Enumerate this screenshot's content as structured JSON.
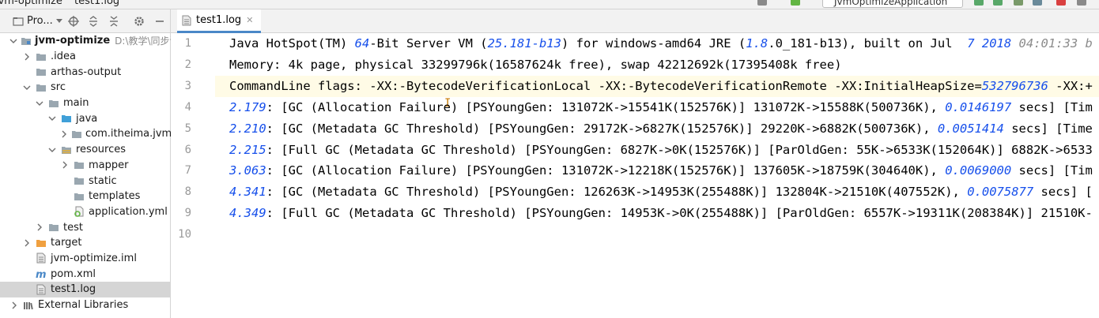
{
  "topbar": {
    "breadcrumb_project": "jvm-optimize",
    "breadcrumb_file": "test1.log",
    "run_config": "JvmOptimizeApplication"
  },
  "project_panel": {
    "title": "Pro..."
  },
  "tree": [
    {
      "label": "jvm-optimize",
      "path": "D:\\教学\\同步课",
      "indent": 0,
      "chevron": "down",
      "icon": "module"
    },
    {
      "label": ".idea",
      "indent": 1,
      "chevron": "right",
      "icon": "folder"
    },
    {
      "label": "arthas-output",
      "indent": 1,
      "chevron": "none",
      "icon": "folder"
    },
    {
      "label": "src",
      "indent": 1,
      "chevron": "down",
      "icon": "folder"
    },
    {
      "label": "main",
      "indent": 2,
      "chevron": "down",
      "icon": "folder"
    },
    {
      "label": "java",
      "indent": 3,
      "chevron": "down",
      "icon": "folder-blue"
    },
    {
      "label": "com.itheima.jvm",
      "indent": 4,
      "chevron": "right",
      "icon": "folder"
    },
    {
      "label": "resources",
      "indent": 3,
      "chevron": "down",
      "icon": "folder-res"
    },
    {
      "label": "mapper",
      "indent": 4,
      "chevron": "right",
      "icon": "folder"
    },
    {
      "label": "static",
      "indent": 4,
      "chevron": "none",
      "icon": "folder"
    },
    {
      "label": "templates",
      "indent": 4,
      "chevron": "none",
      "icon": "folder"
    },
    {
      "label": "application.yml",
      "indent": 4,
      "chevron": "none",
      "icon": "yml"
    },
    {
      "label": "test",
      "indent": 2,
      "chevron": "right",
      "icon": "folder"
    },
    {
      "label": "target",
      "indent": 1,
      "chevron": "right",
      "icon": "folder-orange"
    },
    {
      "label": "jvm-optimize.iml",
      "indent": 1,
      "chevron": "none",
      "icon": "file"
    },
    {
      "label": "pom.xml",
      "indent": 1,
      "chevron": "none",
      "icon": "maven"
    },
    {
      "label": "test1.log",
      "indent": 1,
      "chevron": "none",
      "icon": "file",
      "selected": true
    },
    {
      "label": "External Libraries",
      "indent": 0,
      "chevron": "right",
      "icon": "libs"
    }
  ],
  "editor": {
    "tab_label": "test1.log",
    "lines": [
      {
        "n": "1",
        "segments": [
          [
            "Java HotSpot(TM) ",
            0
          ],
          [
            "64",
            1
          ],
          [
            "-Bit Server VM (",
            0
          ],
          [
            "25.181-b13",
            1
          ],
          [
            ") for windows-amd64 JRE (",
            0
          ],
          [
            "1.8",
            1
          ],
          [
            ".0_181-b13), built on Jul  ",
            0
          ],
          [
            "7 2018",
            1
          ],
          [
            " 04:01:33 b",
            2
          ]
        ]
      },
      {
        "n": "2",
        "segments": [
          [
            "Memory: 4k page, physical 33299796k(16587624k free), swap 42212692k(17395408k free)",
            0
          ]
        ]
      },
      {
        "n": "3",
        "segments": [
          [
            "CommandLine flags: -XX:-BytecodeVerificationLocal -XX:-BytecodeVerificationRemote -XX:InitialHeapSize=",
            0
          ],
          [
            "532796736",
            1
          ],
          [
            " -XX:+",
            0
          ]
        ]
      },
      {
        "n": "4",
        "segments": [
          [
            "2.179",
            1
          ],
          [
            ": [GC (Allocation Failure) [PSYoungGen: 131072K->15541K(152576K)] 131072K->15588K(500736K), ",
            0
          ],
          [
            "0.0146197",
            1
          ],
          [
            " secs] [Tim",
            0
          ]
        ]
      },
      {
        "n": "5",
        "segments": [
          [
            "2.210",
            1
          ],
          [
            ": [GC (Metadata GC Threshold) [PSYoungGen: 29172K->6827K(152576K)] 29220K->6882K(500736K), ",
            0
          ],
          [
            "0.0051414",
            1
          ],
          [
            " secs] [Time",
            0
          ]
        ]
      },
      {
        "n": "6",
        "segments": [
          [
            "2.215",
            1
          ],
          [
            ": [Full GC (Metadata GC Threshold) [PSYoungGen: 6827K->0K(152576K)] [ParOldGen: 55K->6533K(152064K)] 6882K->6533",
            0
          ]
        ]
      },
      {
        "n": "7",
        "segments": [
          [
            "3.063",
            1
          ],
          [
            ": [GC (Allocation Failure) [PSYoungGen: 131072K->12218K(152576K)] 137605K->18759K(304640K), ",
            0
          ],
          [
            "0.0069000",
            1
          ],
          [
            " secs] [Tim",
            0
          ]
        ]
      },
      {
        "n": "8",
        "segments": [
          [
            "4.341",
            1
          ],
          [
            ": [GC (Metadata GC Threshold) [PSYoungGen: 126263K->14953K(255488K)] 132804K->21510K(407552K), ",
            0
          ],
          [
            "0.0075877",
            1
          ],
          [
            " secs] [",
            0
          ]
        ]
      },
      {
        "n": "9",
        "segments": [
          [
            "4.349",
            1
          ],
          [
            ": [Full GC (Metadata GC Threshold) [PSYoungGen: 14953K->0K(255488K)] [ParOldGen: 6557K->19311K(208384K)] 21510K-",
            0
          ]
        ]
      },
      {
        "n": "10",
        "segments": []
      }
    ]
  },
  "colors": {
    "number": "#1750eb",
    "gutter_text": "#999999",
    "selection": "#d5d5d5",
    "folder": "#9aa7b0",
    "folder_blue": "#40a0d8",
    "folder_orange": "#f0a040",
    "tab_underline": "#4a88c7"
  }
}
